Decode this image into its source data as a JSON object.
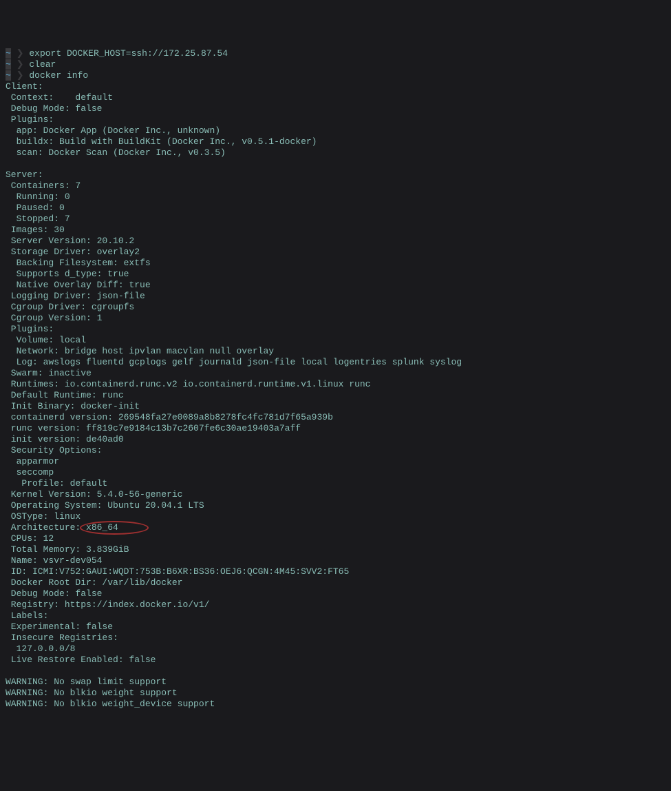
{
  "prompt": {
    "tilde": "~",
    "arrow": "❯"
  },
  "commands": {
    "c1": "export DOCKER_HOST=ssh://172.25.87.54",
    "c2": "clear",
    "c3": "docker info"
  },
  "output": {
    "client": {
      "header": "Client:",
      "context": " Context:    default",
      "debug": " Debug Mode: false",
      "plugins_header": " Plugins:",
      "app": "  app: Docker App (Docker Inc., unknown)",
      "buildx": "  buildx: Build with BuildKit (Docker Inc., v0.5.1-docker)",
      "scan": "  scan: Docker Scan (Docker Inc., v0.3.5)"
    },
    "server": {
      "header": "Server:",
      "containers": " Containers: 7",
      "running": "  Running: 0",
      "paused": "  Paused: 0",
      "stopped": "  Stopped: 7",
      "images": " Images: 30",
      "version": " Server Version: 20.10.2",
      "storage": " Storage Driver: overlay2",
      "backing": "  Backing Filesystem: extfs",
      "dtype": "  Supports d_type: true",
      "diff": "  Native Overlay Diff: true",
      "logging": " Logging Driver: json-file",
      "cgroup_driver": " Cgroup Driver: cgroupfs",
      "cgroup_version": " Cgroup Version: 1",
      "plugins_header": " Plugins:",
      "volume": "  Volume: local",
      "network": "  Network: bridge host ipvlan macvlan null overlay",
      "log": "  Log: awslogs fluentd gcplogs gelf journald json-file local logentries splunk syslog",
      "swarm": " Swarm: inactive",
      "runtimes": " Runtimes: io.containerd.runc.v2 io.containerd.runtime.v1.linux runc",
      "default_runtime": " Default Runtime: runc",
      "init_binary": " Init Binary: docker-init",
      "containerd_ver": " containerd version: 269548fa27e0089a8b8278fc4fc781d7f65a939b",
      "runc_ver": " runc version: ff819c7e9184c13b7c2607fe6c30ae19403a7aff",
      "init_ver": " init version: de40ad0",
      "security": " Security Options:",
      "apparmor": "  apparmor",
      "seccomp": "  seccomp",
      "profile": "   Profile: default",
      "kernel": " Kernel Version: 5.4.0-56-generic",
      "os": " Operating System: Ubuntu 20.04.1 LTS",
      "ostype": " OSType: linux",
      "arch": " Architecture: x86_64",
      "cpus": " CPUs: 12",
      "memory": " Total Memory: 3.839GiB",
      "name": " Name: vsvr-dev054",
      "id": " ID: ICMI:V752:GAUI:WQDT:753B:B6XR:BS36:OEJ6:QCGN:4M45:SVV2:FT65",
      "root_dir": " Docker Root Dir: /var/lib/docker",
      "debug": " Debug Mode: false",
      "registry": " Registry: https://index.docker.io/v1/",
      "labels": " Labels:",
      "experimental": " Experimental: false",
      "insecure": " Insecure Registries:",
      "insecure_item": "  127.0.0.0/8",
      "live_restore": " Live Restore Enabled: false"
    },
    "warnings": {
      "w1": "WARNING: No swap limit support",
      "w2": "WARNING: No blkio weight support",
      "w3": "WARNING: No blkio weight_device support"
    }
  },
  "highlight": {
    "target": "x86_64"
  }
}
